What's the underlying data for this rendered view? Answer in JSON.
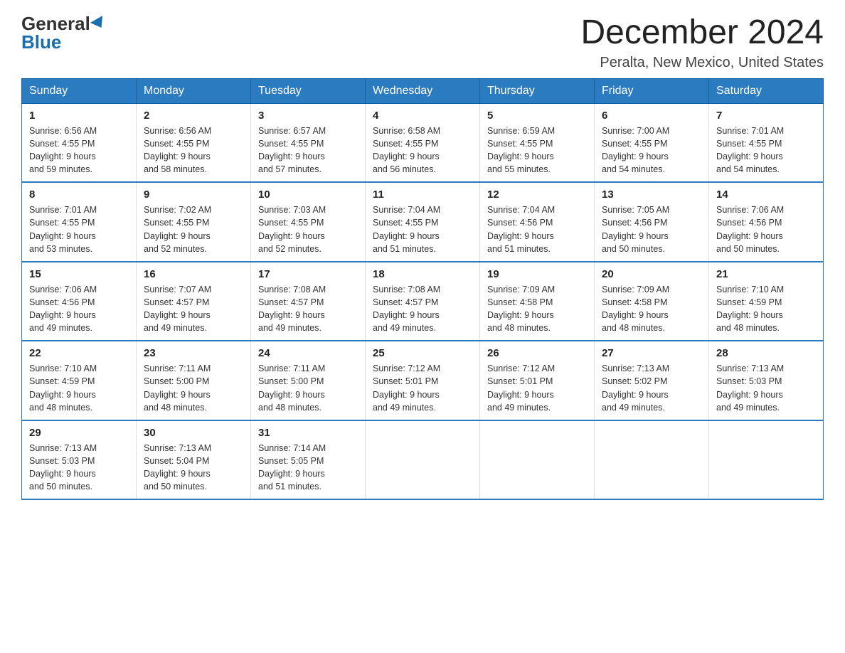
{
  "logo": {
    "general": "General",
    "blue": "Blue"
  },
  "title": "December 2024",
  "subtitle": "Peralta, New Mexico, United States",
  "days_of_week": [
    "Sunday",
    "Monday",
    "Tuesday",
    "Wednesday",
    "Thursday",
    "Friday",
    "Saturday"
  ],
  "weeks": [
    [
      {
        "day": "1",
        "sunrise": "6:56 AM",
        "sunset": "4:55 PM",
        "daylight": "9 hours and 59 minutes."
      },
      {
        "day": "2",
        "sunrise": "6:56 AM",
        "sunset": "4:55 PM",
        "daylight": "9 hours and 58 minutes."
      },
      {
        "day": "3",
        "sunrise": "6:57 AM",
        "sunset": "4:55 PM",
        "daylight": "9 hours and 57 minutes."
      },
      {
        "day": "4",
        "sunrise": "6:58 AM",
        "sunset": "4:55 PM",
        "daylight": "9 hours and 56 minutes."
      },
      {
        "day": "5",
        "sunrise": "6:59 AM",
        "sunset": "4:55 PM",
        "daylight": "9 hours and 55 minutes."
      },
      {
        "day": "6",
        "sunrise": "7:00 AM",
        "sunset": "4:55 PM",
        "daylight": "9 hours and 54 minutes."
      },
      {
        "day": "7",
        "sunrise": "7:01 AM",
        "sunset": "4:55 PM",
        "daylight": "9 hours and 54 minutes."
      }
    ],
    [
      {
        "day": "8",
        "sunrise": "7:01 AM",
        "sunset": "4:55 PM",
        "daylight": "9 hours and 53 minutes."
      },
      {
        "day": "9",
        "sunrise": "7:02 AM",
        "sunset": "4:55 PM",
        "daylight": "9 hours and 52 minutes."
      },
      {
        "day": "10",
        "sunrise": "7:03 AM",
        "sunset": "4:55 PM",
        "daylight": "9 hours and 52 minutes."
      },
      {
        "day": "11",
        "sunrise": "7:04 AM",
        "sunset": "4:55 PM",
        "daylight": "9 hours and 51 minutes."
      },
      {
        "day": "12",
        "sunrise": "7:04 AM",
        "sunset": "4:56 PM",
        "daylight": "9 hours and 51 minutes."
      },
      {
        "day": "13",
        "sunrise": "7:05 AM",
        "sunset": "4:56 PM",
        "daylight": "9 hours and 50 minutes."
      },
      {
        "day": "14",
        "sunrise": "7:06 AM",
        "sunset": "4:56 PM",
        "daylight": "9 hours and 50 minutes."
      }
    ],
    [
      {
        "day": "15",
        "sunrise": "7:06 AM",
        "sunset": "4:56 PM",
        "daylight": "9 hours and 49 minutes."
      },
      {
        "day": "16",
        "sunrise": "7:07 AM",
        "sunset": "4:57 PM",
        "daylight": "9 hours and 49 minutes."
      },
      {
        "day": "17",
        "sunrise": "7:08 AM",
        "sunset": "4:57 PM",
        "daylight": "9 hours and 49 minutes."
      },
      {
        "day": "18",
        "sunrise": "7:08 AM",
        "sunset": "4:57 PM",
        "daylight": "9 hours and 49 minutes."
      },
      {
        "day": "19",
        "sunrise": "7:09 AM",
        "sunset": "4:58 PM",
        "daylight": "9 hours and 48 minutes."
      },
      {
        "day": "20",
        "sunrise": "7:09 AM",
        "sunset": "4:58 PM",
        "daylight": "9 hours and 48 minutes."
      },
      {
        "day": "21",
        "sunrise": "7:10 AM",
        "sunset": "4:59 PM",
        "daylight": "9 hours and 48 minutes."
      }
    ],
    [
      {
        "day": "22",
        "sunrise": "7:10 AM",
        "sunset": "4:59 PM",
        "daylight": "9 hours and 48 minutes."
      },
      {
        "day": "23",
        "sunrise": "7:11 AM",
        "sunset": "5:00 PM",
        "daylight": "9 hours and 48 minutes."
      },
      {
        "day": "24",
        "sunrise": "7:11 AM",
        "sunset": "5:00 PM",
        "daylight": "9 hours and 48 minutes."
      },
      {
        "day": "25",
        "sunrise": "7:12 AM",
        "sunset": "5:01 PM",
        "daylight": "9 hours and 49 minutes."
      },
      {
        "day": "26",
        "sunrise": "7:12 AM",
        "sunset": "5:01 PM",
        "daylight": "9 hours and 49 minutes."
      },
      {
        "day": "27",
        "sunrise": "7:13 AM",
        "sunset": "5:02 PM",
        "daylight": "9 hours and 49 minutes."
      },
      {
        "day": "28",
        "sunrise": "7:13 AM",
        "sunset": "5:03 PM",
        "daylight": "9 hours and 49 minutes."
      }
    ],
    [
      {
        "day": "29",
        "sunrise": "7:13 AM",
        "sunset": "5:03 PM",
        "daylight": "9 hours and 50 minutes."
      },
      {
        "day": "30",
        "sunrise": "7:13 AM",
        "sunset": "5:04 PM",
        "daylight": "9 hours and 50 minutes."
      },
      {
        "day": "31",
        "sunrise": "7:14 AM",
        "sunset": "5:05 PM",
        "daylight": "9 hours and 51 minutes."
      },
      null,
      null,
      null,
      null
    ]
  ]
}
